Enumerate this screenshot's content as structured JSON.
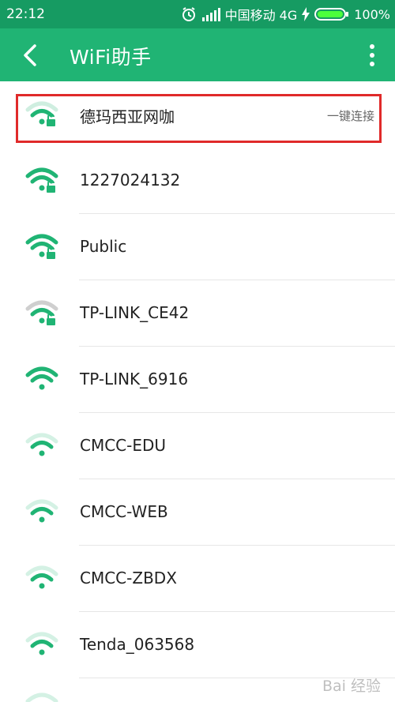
{
  "status_bar": {
    "time": "22:12",
    "carrier": "中国移动 4G",
    "battery": "100%"
  },
  "app_bar": {
    "title": "WiFi助手"
  },
  "wifi_list": [
    {
      "ssid": "德玛西亚网咖",
      "action": "一键连接",
      "icon": "wifi-lock-partial-green-icon"
    },
    {
      "ssid": "1227024132",
      "icon": "wifi-lock-green-icon"
    },
    {
      "ssid": "Public",
      "icon": "wifi-lock-green-icon"
    },
    {
      "ssid": "TP-LINK_CE42",
      "icon": "wifi-lock-gray-icon"
    },
    {
      "ssid": "TP-LINK_6916",
      "icon": "wifi-open-green-icon"
    },
    {
      "ssid": "CMCC-EDU",
      "icon": "wifi-weak-open-icon"
    },
    {
      "ssid": "CMCC-WEB",
      "icon": "wifi-weak-open-icon"
    },
    {
      "ssid": "CMCC-ZBDX",
      "icon": "wifi-weak-open-icon"
    },
    {
      "ssid": "Tenda_063568",
      "icon": "wifi-weak-open-icon"
    }
  ],
  "watermark": {
    "text": "Bai 经验"
  },
  "colors": {
    "status_bar": "#169b62",
    "app_bar": "#20b474",
    "wifi_green": "#20b474",
    "wifi_gray": "#bdbdbd"
  }
}
